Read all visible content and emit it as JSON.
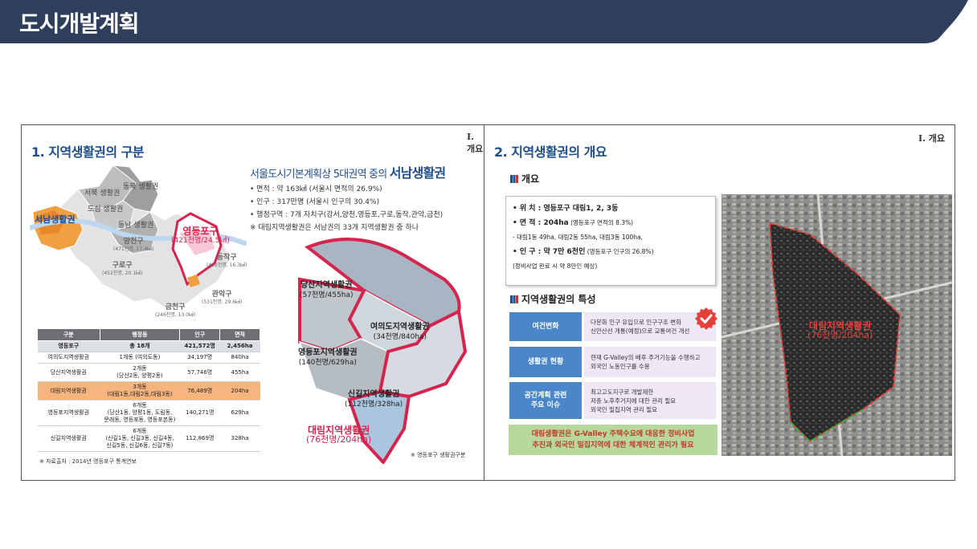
{
  "header": {
    "title": "도시개발계획",
    "bar_color": "#2f3e5a"
  },
  "left_slide": {
    "section_title": "1. 지역생활권의 구분",
    "corner_label": "I. 개요",
    "headline_prefix": "서울도시기본계획상 5대권역 중의",
    "headline_emph": "서남생활권",
    "bullets": [
      "• 면적 : 약 163㎢ (서울시 면적의 26.9%)",
      "• 인구 : 317만명 (서울시 인구의 30.4%)",
      "• 행정구역 : 7개 자치구(강서,양천,영등포,구로,동작,관악,금천)",
      "※  대림지역생활권은 서남권의 33개 지역생활권 중 하나"
    ],
    "seoul_map": {
      "seonam_label": "서남생활권",
      "north_labels": [
        "서북 생활권",
        "동북 생활권",
        "도심 생활권",
        "동남 생활권"
      ],
      "districts": [
        {
          "name": "양천구",
          "sub": "(471천명, 17.4㎢)"
        },
        {
          "name": "구로구",
          "sub": "(452천명, 20.1㎢)"
        },
        {
          "name": "동작구",
          "sub": "(402천명, 16.3㎢)"
        },
        {
          "name": "금천구",
          "sub": "(246천명, 13.0㎢)"
        },
        {
          "name": "관악구",
          "sub": "(531천명, 29.6㎢)"
        }
      ],
      "yeongdeungpo_label": "영등포구",
      "yeongdeungpo_sub": "(421천명/24.5㎢)"
    },
    "table": {
      "headers": [
        "구분",
        "행정동",
        "인구",
        "면적"
      ],
      "rows": [
        {
          "name": "영등포구",
          "dong": "총 18개",
          "pop": "421,572명",
          "area": "2,456ha",
          "kind": "total"
        },
        {
          "name": "여의도지역생활권",
          "dong": "1개동 (여의도동)",
          "pop": "34,197명",
          "area": "840ha",
          "kind": "normal"
        },
        {
          "name": "당산지역생활권",
          "dong": "2개동\n(당산2동, 양평2동)",
          "pop": "57,746명",
          "area": "455ha",
          "kind": "normal"
        },
        {
          "name": "대림지역생활권",
          "dong": "3개동\n(대림1동,대림2동,대림3동)",
          "pop": "76,489명",
          "area": "204ha",
          "kind": "highlight"
        },
        {
          "name": "영등포지역생활권",
          "dong": "6개동\n(당산1동, 양평1동, 도림동,\n문래동, 영등포동, 영등포본동)",
          "pop": "140,271명",
          "area": "629ha",
          "kind": "normal"
        },
        {
          "name": "신길지역생활권",
          "dong": "6개동\n(신길1동, 신길3동, 신길4동,\n신길5동, 신길6동, 신길7동)",
          "pop": "112,869명",
          "area": "328ha",
          "kind": "normal"
        }
      ]
    },
    "table_source": "※ 자료출처 : 2014년 영등포구 통계연보",
    "area_map": {
      "labels": [
        {
          "name": "당산지역생활권",
          "sub": "(57천명/455ha)"
        },
        {
          "name": "여의도지역생활권",
          "sub": "(34천명/840ha)"
        },
        {
          "name": "영등포지역생활권",
          "sub": "(140천명/629ha)"
        },
        {
          "name": "신길지역생활권",
          "sub": "(112천명/328ha)"
        },
        {
          "name": "대림지역생활권",
          "sub": "(76천명/204ha)"
        }
      ],
      "source": "※ 영등포구 생활권구분"
    }
  },
  "right_slide": {
    "section_title": "2. 지역생활권의 개요",
    "corner_label": "I. 개요",
    "overview_heading": "개요",
    "overview_lines": [
      {
        "label": "• 위  치 : 영등포구 대림1, 2, 3동",
        "note": ""
      },
      {
        "label": "• 면  적 : 204ha",
        "note": " (영등포구 면적의 8.3%)"
      },
      {
        "label": " - 대림1동 49ha, 대림2동 55ha, 대림3동 100ha,",
        "note": ""
      },
      {
        "label": "• 인  구 : 약 7만 6천인",
        "note": " (영등포구 인구의 26.8%)"
      },
      {
        "label": "           (정비사업 완료 시 약 8만인 예상)",
        "note": ""
      }
    ],
    "features_heading": "지역생활권의 특성",
    "features": [
      {
        "label": "여건변화",
        "desc": [
          "다문화 인구 유입으로 인구구조 변화",
          "신안산선 개통(예정)으로 교통여건 개선"
        ]
      },
      {
        "label": "생활권 현황",
        "desc": [
          "현재 G-Valley의 배후 주거기능을 수행하고",
          "외국인 노동인구를 수용"
        ]
      },
      {
        "label": "공간계획 관련\n주요 이슈",
        "desc": [
          "최고고도지구로 개발제한",
          "저층 노후주거지에 대한 관리 필요",
          "외국인 밀집지역 관리 필요"
        ]
      }
    ],
    "banner": [
      "대림생활권은 G-Valley 주택수요에 대응한 정비사업",
      "추진과 외국인 밀집지역에 대한 체계적인 관리가 필요"
    ],
    "photo_label": "대림지역생활권",
    "photo_sub": "(76천명/204ha)"
  }
}
